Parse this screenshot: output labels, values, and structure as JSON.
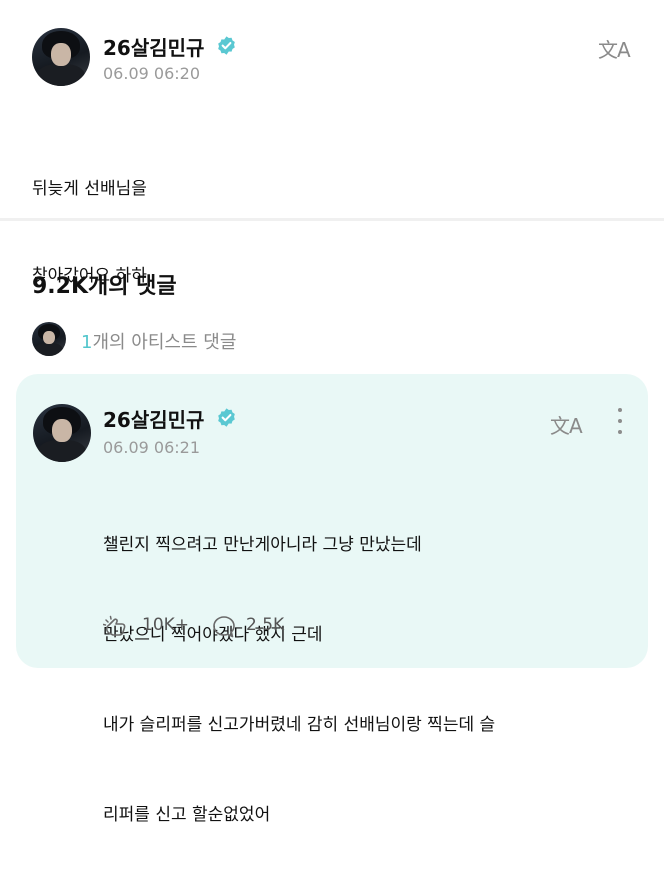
{
  "post": {
    "author": "26살김민규",
    "timestamp": "06.09 06:20",
    "translate_icon": "文A",
    "body_lines": [
      "뒤늦게 선배님을",
      "찾아갔어요 하하"
    ]
  },
  "comments_section": {
    "count_label": "9.2K개의 댓글",
    "artist_comment_count": "1",
    "artist_comment_suffix": "개의 아티스트 댓글"
  },
  "artist_comment": {
    "author": "26살김민규",
    "timestamp": "06.09 06:21",
    "translate_icon": "文A",
    "body_lines": [
      "챌린지 찍으려고 만난게아니라 그냥 만났는데",
      "만났으니 찍어야겠다 했지 근데",
      "내가 슬리퍼를 신고가버렸네 감히 선배님이랑 찍는데 슬",
      "리퍼를 신고 할순없었어"
    ],
    "likes": "10K+",
    "replies": "2.5K"
  },
  "colors": {
    "accent": "#53c6cc",
    "card_background": "#e9f8f6",
    "verified_badge": "#5ac8d2"
  }
}
